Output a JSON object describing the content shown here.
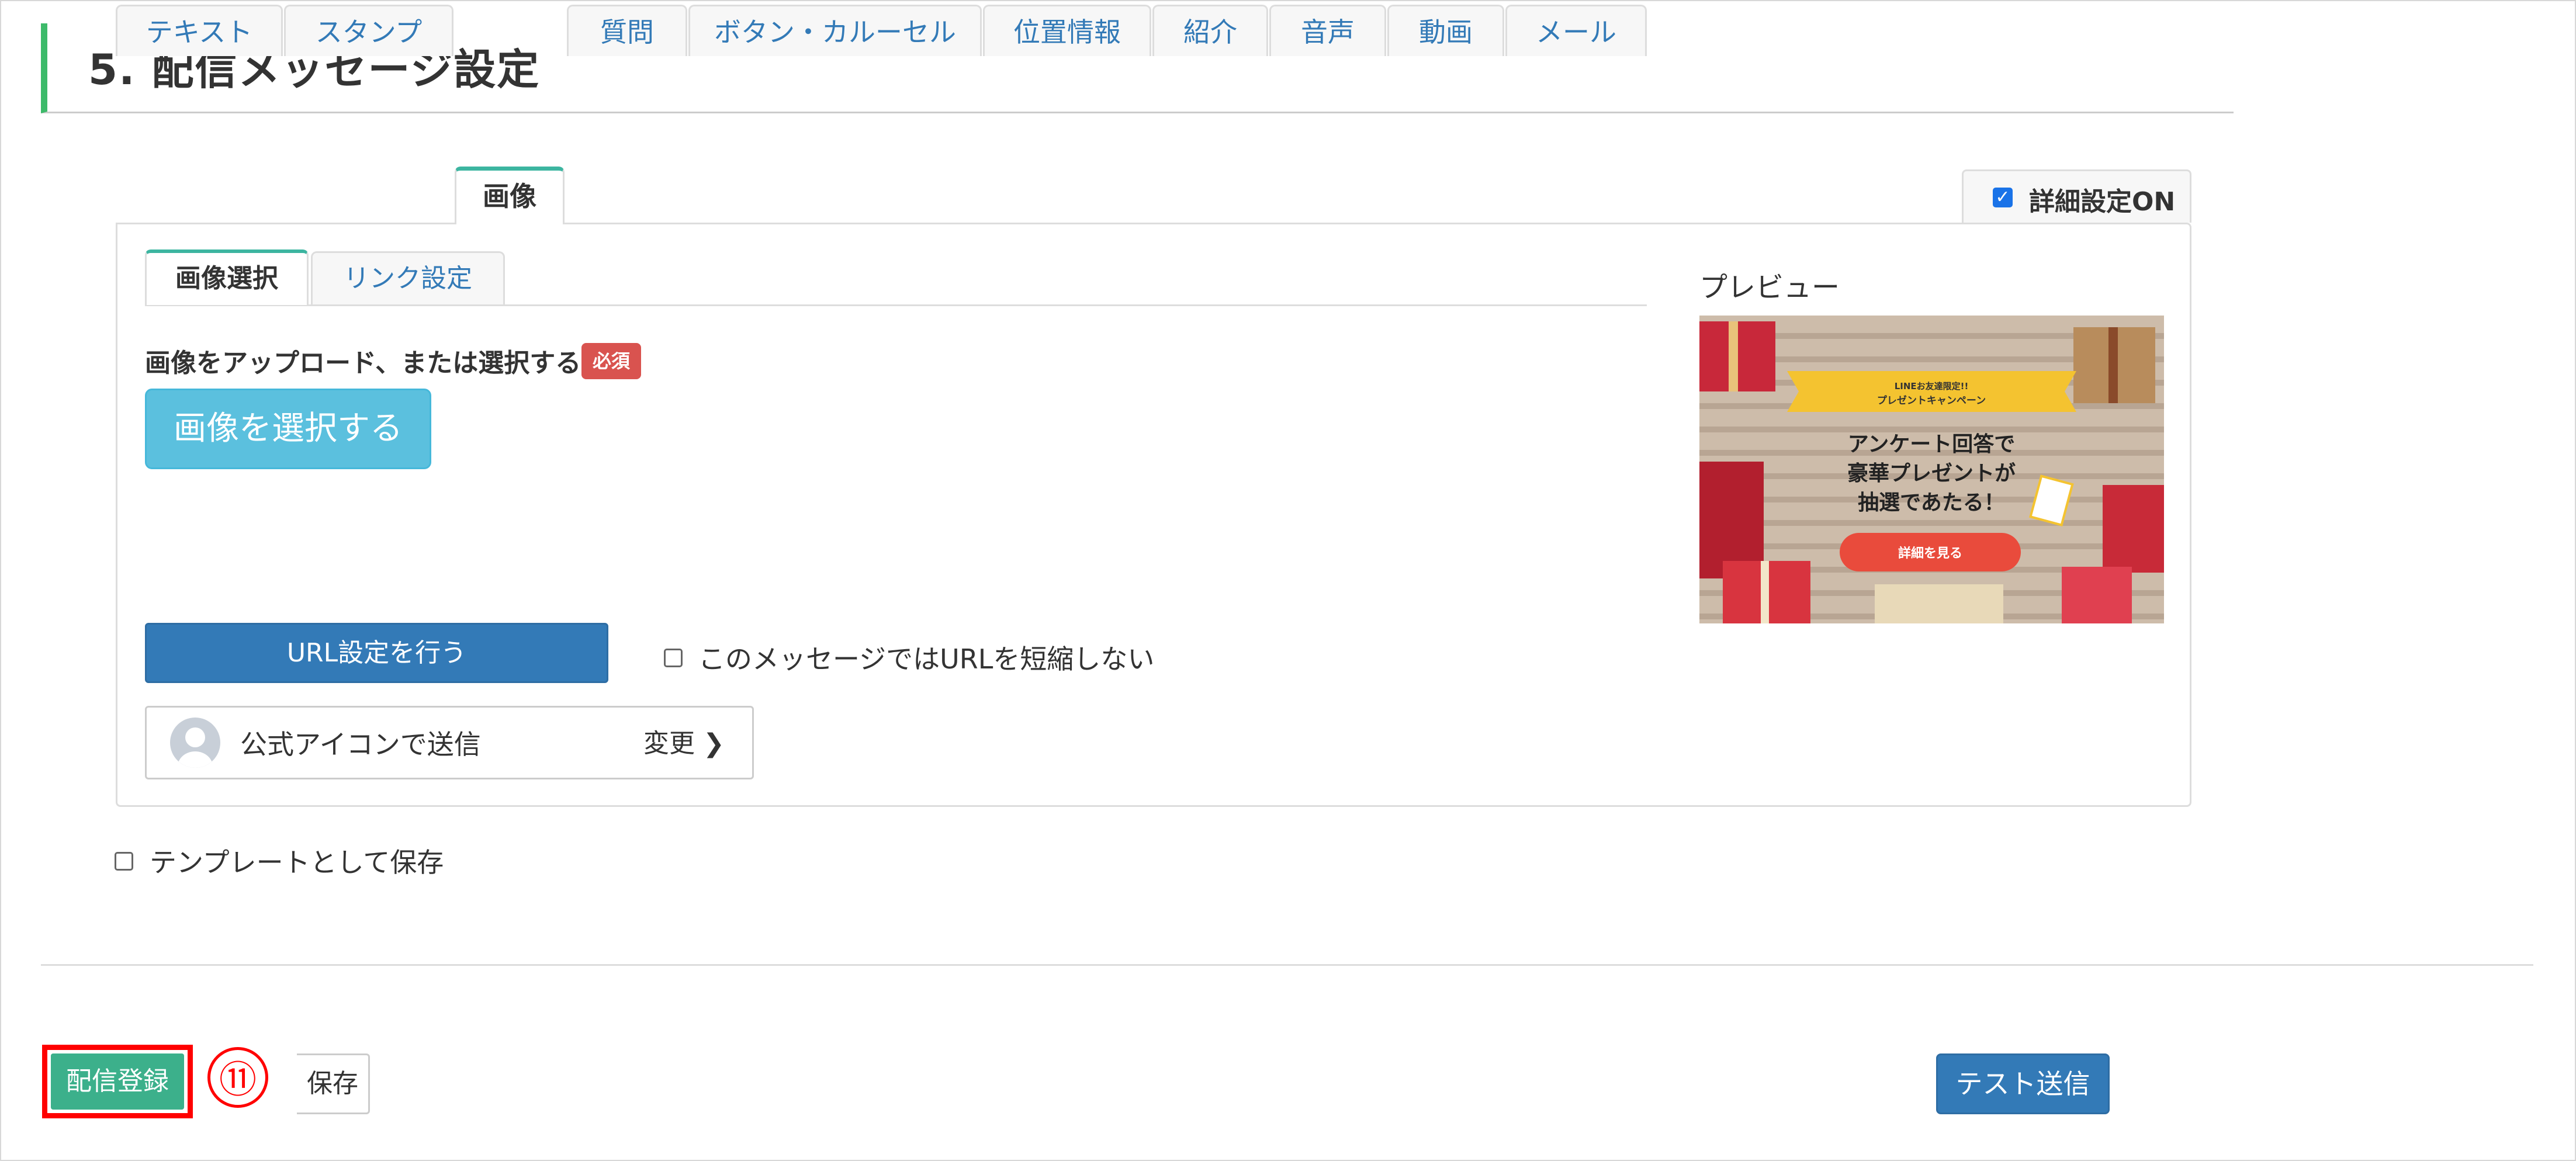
{
  "section": {
    "title": "5. 配信メッセージ設定"
  },
  "tabs": [
    {
      "label": "テキスト",
      "active": false
    },
    {
      "label": "スタンプ",
      "active": false
    },
    {
      "label": "画像",
      "active": true
    },
    {
      "label": "質問",
      "active": false
    },
    {
      "label": "ボタン・カルーセル",
      "active": false
    },
    {
      "label": "位置情報",
      "active": false
    },
    {
      "label": "紹介",
      "active": false
    },
    {
      "label": "音声",
      "active": false
    },
    {
      "label": "動画",
      "active": false
    },
    {
      "label": "メール",
      "active": false
    }
  ],
  "advanced": {
    "label": "詳細設定ON",
    "checked": true
  },
  "subtabs": [
    {
      "label": "画像選択",
      "active": true
    },
    {
      "label": "リンク設定",
      "active": false
    }
  ],
  "upload": {
    "label": "画像をアップロード、または選択する",
    "required_badge": "必須",
    "select_button": "画像を選択する"
  },
  "preview": {
    "label": "プレビュー",
    "banner_ribbon_top": "LINEお友達限定!!",
    "banner_ribbon_bottom": "プレゼントキャンペーン",
    "banner_line1": "アンケート回答で",
    "banner_line2": "豪華プレゼントが",
    "banner_line3": "抽選であたる！",
    "banner_button": "詳細を見る"
  },
  "url": {
    "button": "URL設定を行う",
    "no_shorten_label": "このメッセージではURLを短縮しない",
    "no_shorten_checked": false
  },
  "sender": {
    "name": "公式アイコンで送信",
    "change": "変更"
  },
  "template": {
    "label": "テンプレートとして保存",
    "checked": false
  },
  "footer": {
    "register_button": "配信登録",
    "step_marker": "⑪",
    "save_button": "保存",
    "test_button": "テスト送信"
  },
  "colors": {
    "accent_green": "#3dba6a",
    "tab_active_border": "#3cb5a0",
    "primary_blue": "#337ab7",
    "info_blue": "#5bc0de",
    "danger_red": "#d9534f",
    "register_green": "#3cb08b",
    "highlight_red": "#ff0000"
  }
}
